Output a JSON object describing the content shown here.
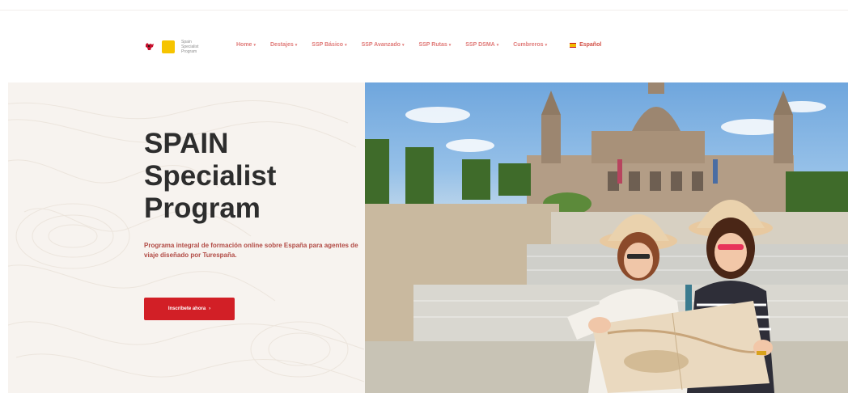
{
  "brand": {
    "logo_caption": "Spain Specialist Program"
  },
  "nav": {
    "items": [
      {
        "label": "Home"
      },
      {
        "label": "Destajes"
      },
      {
        "label": "SSP Básico"
      },
      {
        "label": "SSP Avanzado"
      },
      {
        "label": "SSP Rutas"
      },
      {
        "label": "SSP DSMA"
      },
      {
        "label": "Cumbreros"
      }
    ],
    "language": "Español"
  },
  "hero": {
    "title_line1": "SPAIN",
    "title_line2": "Specialist",
    "title_line3": "Program",
    "subtitle": "Programa integral de formación online sobre España para agentes de viaje diseñado por Turespaña.",
    "cta_label": "Inscríbete ahora",
    "cta_arrow": "›"
  },
  "colors": {
    "accent_red": "#d21f26",
    "nav_link": "#e07a78",
    "hero_bg": "#f7f3ef",
    "title": "#2d2d2d",
    "logo_yellow": "#f6c400"
  },
  "icons": {
    "logo_bull": "bull-logo-icon",
    "logo_badge": "ssp-badge-icon",
    "flag": "spain-flag-icon",
    "caret": "chevron-down-icon"
  }
}
